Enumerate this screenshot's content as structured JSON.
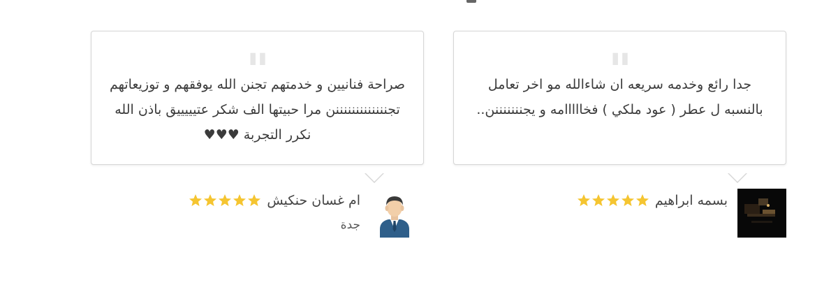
{
  "reviews": [
    {
      "text": "صراحة فنانيين و خدمتهم تجنن الله يوفقهم و توزيعاتهم تجنننننننننننننن مرا حبيتها الف شكر عتيييييق باذن الله نكرر التجربة ♥♥♥",
      "author": "ام غسان حنكيش",
      "city": "جدة",
      "rating": 5,
      "avatar_icon": "person-avatar-icon"
    },
    {
      "text": "جدا رائع وخدمه سريعه ان شاءالله مو اخر تعامل بالنسبه ل عطر ( عود ملكي ) فخااااامه و يجنننننننن..",
      "author": "بسمه ابراهيم",
      "city": "",
      "rating": 5,
      "avatar_icon": "user-photo"
    }
  ],
  "colors": {
    "star": "#f5c531",
    "quote": "#e6e6e6",
    "border": "#d6d6d6"
  }
}
